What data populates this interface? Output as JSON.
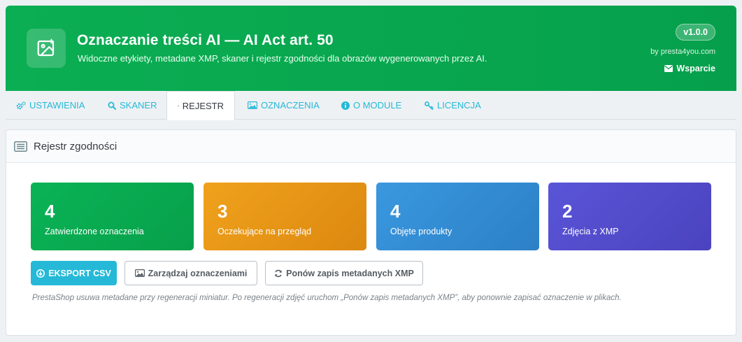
{
  "header": {
    "title": "Oznaczanie treści AI — AI Act art. 50",
    "subtitle": "Widoczne etykiety, metadane XMP, skaner i rejestr zgodności dla obrazów wygenerowanych przez AI.",
    "version": "v1.0.0",
    "byline": "by presta4you.com",
    "support_label": "Wsparcie",
    "color": "#0bae53"
  },
  "tabs": [
    {
      "label": "USTAWIENIA",
      "icon": "gears-icon"
    },
    {
      "label": "SKANER",
      "icon": "search-icon"
    },
    {
      "label": "REJESTR",
      "icon": "list-icon",
      "active": true
    },
    {
      "label": "OZNACZENIA",
      "icon": "image-icon"
    },
    {
      "label": "O MODULE",
      "icon": "info-icon"
    },
    {
      "label": "LICENCJA",
      "icon": "key-icon"
    }
  ],
  "panel": {
    "title": "Rejestr zgodności",
    "stats": [
      {
        "value": "4",
        "label": "Zatwierdzone oznaczenia",
        "color": "#0ab356"
      },
      {
        "value": "3",
        "label": "Oczekujące na przegląd",
        "color": "#f0a21c"
      },
      {
        "value": "4",
        "label": "Objęte produkty",
        "color": "#3a98df"
      },
      {
        "value": "2",
        "label": "Zdjęcia z XMP",
        "color": "#5a55d8"
      }
    ],
    "buttons": {
      "export": "EKSPORT CSV",
      "manage": "Zarządzaj oznaczeniami",
      "rewrite": "Ponów zapis metadanych XMP"
    },
    "note": "PrestaShop usuwa metadane przy regeneracji miniatur. Po regeneracji zdjęć uruchom „Ponów zapis metadanych XMP”, aby ponownie zapisać oznaczenie w plikach."
  }
}
